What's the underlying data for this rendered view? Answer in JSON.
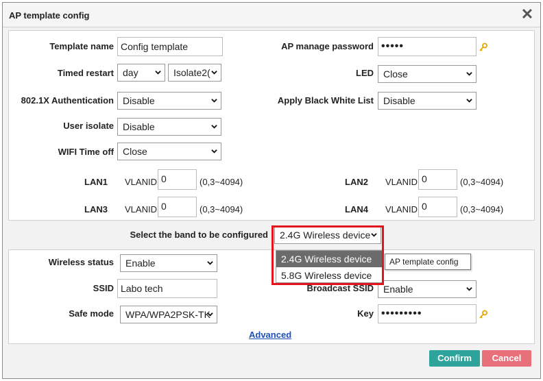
{
  "dialog": {
    "title": "AP template config",
    "close_glyph": "✕"
  },
  "form": {
    "template_name": {
      "label": "Template name",
      "value": "Config template"
    },
    "ap_password": {
      "label": "AP manage password",
      "value": "•••••",
      "icon": "key-icon"
    },
    "timed_restart": {
      "label": "Timed restart",
      "period": "day",
      "time": "Isolate2("
    },
    "led": {
      "label": "LED",
      "value": "Close"
    },
    "auth_8021x": {
      "label": "802.1X Authentication",
      "value": "Disable"
    },
    "black_white_list": {
      "label": "Apply Black White List",
      "value": "Disable"
    },
    "user_isolate": {
      "label": "User isolate",
      "value": "Disable"
    },
    "wifi_time_off": {
      "label": "WIFI Time off",
      "value": "Close"
    },
    "lans": [
      {
        "name": "LAN1",
        "vlan_label": "VLANID",
        "vlan_value": "0",
        "range": "(0,3~4094)"
      },
      {
        "name": "LAN2",
        "vlan_label": "VLANID",
        "vlan_value": "0",
        "range": "(0,3~4094)"
      },
      {
        "name": "LAN3",
        "vlan_label": "VLANID",
        "vlan_value": "0",
        "range": "(0,3~4094)"
      },
      {
        "name": "LAN4",
        "vlan_label": "VLANID",
        "vlan_value": "0",
        "range": "(0,3~4094)"
      }
    ]
  },
  "band": {
    "label": "Select the band to be configured",
    "selected": "2.4G Wireless device",
    "options": [
      "2.4G Wireless device",
      "5.8G Wireless device"
    ],
    "highlight_color": "#e3141b"
  },
  "tooltip": "AP template config",
  "wireless": {
    "status": {
      "label": "Wireless status",
      "value": "Enable"
    },
    "ssid": {
      "label": "SSID",
      "value": "Labo tech"
    },
    "broadcast_ssid": {
      "label": "Broadcast SSID",
      "value": "Enable"
    },
    "safe_mode": {
      "label": "Safe mode",
      "value": "WPA/WPA2PSK-TK"
    },
    "key": {
      "label": "Key",
      "value": "•••••••••",
      "icon": "key-icon"
    },
    "advanced_link": "Advanced"
  },
  "buttons": {
    "confirm": "Confirm",
    "cancel": "Cancel",
    "confirm_color": "#2da39b",
    "cancel_color": "#e8707b"
  }
}
